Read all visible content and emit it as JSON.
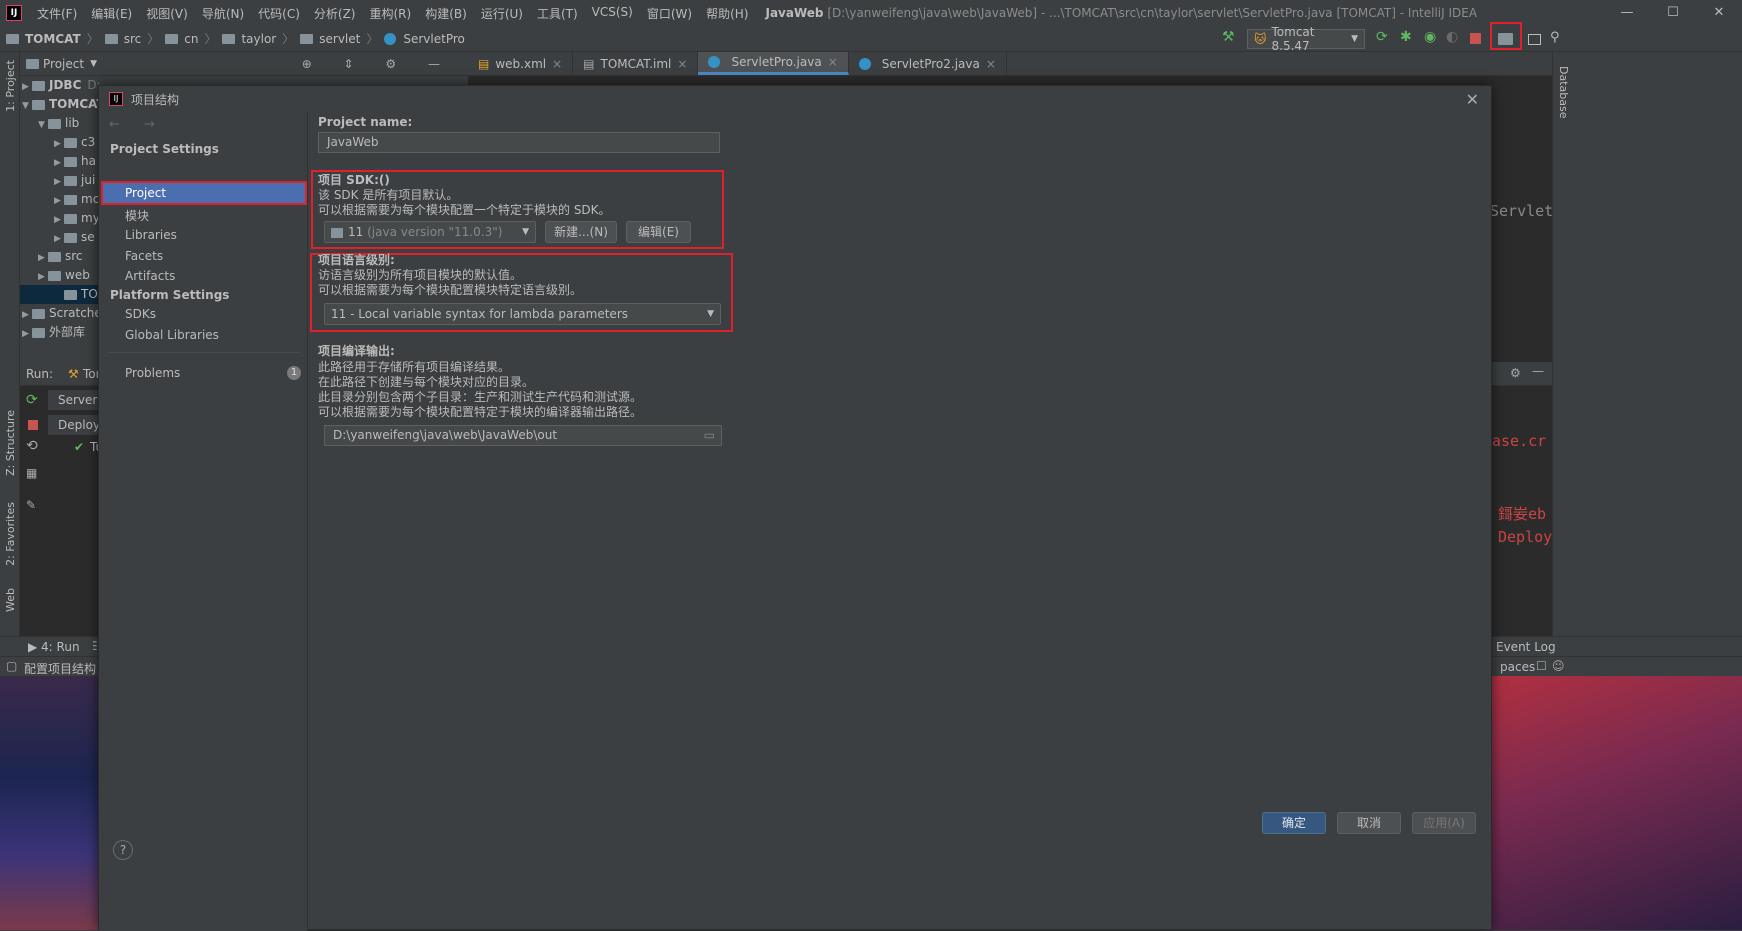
{
  "window": {
    "menus": [
      "文件(F)",
      "编辑(E)",
      "视图(V)",
      "导航(N)",
      "代码(C)",
      "分析(Z)",
      "重构(R)",
      "构建(B)",
      "运行(U)",
      "工具(T)",
      "VCS(S)",
      "窗口(W)",
      "帮助(H)"
    ],
    "title_bold": "JavaWeb",
    "title_rest": "[D:\\yanweifeng\\java\\web\\JavaWeb] - ...\\TOMCAT\\src\\cn\\taylor\\servlet\\ServletPro.java [TOMCAT] - IntelliJ IDEA",
    "min": "—",
    "max": "☐",
    "close": "✕"
  },
  "breadcrumb": [
    "TOMCAT",
    "src",
    "cn",
    "taylor",
    "servlet",
    "ServletPro"
  ],
  "run_config": "Tomcat 8.5.47",
  "left_strip": {
    "project": "1: Project",
    "structure": "Z: Structure",
    "favorites": "2: Favorites",
    "web": "Web"
  },
  "right_strip": {
    "database": "Database"
  },
  "project_panel": {
    "title": "Project",
    "tree": [
      {
        "arrow": "▶",
        "label": "JDBC",
        "extra": "D:..."
      },
      {
        "arrow": "▼",
        "label": "TOMCAT"
      },
      {
        "arrow": "▼",
        "label": "lib"
      },
      {
        "arrow": "▶",
        "label": "c3"
      },
      {
        "arrow": "▶",
        "label": "ha"
      },
      {
        "arrow": "▶",
        "label": "jui"
      },
      {
        "arrow": "▶",
        "label": "mc"
      },
      {
        "arrow": "▶",
        "label": "my"
      },
      {
        "arrow": "▶",
        "label": "se"
      },
      {
        "arrow": "▶",
        "label": "src"
      },
      {
        "arrow": "▶",
        "label": "web"
      },
      {
        "arrow": "",
        "label": "TOMC"
      },
      {
        "arrow": "▶",
        "label": "Scratche"
      },
      {
        "arrow": "▶",
        "label": "外部库"
      }
    ]
  },
  "editor_tabs": [
    "web.xml",
    "TOMCAT.iml",
    "ServletPro.java",
    "ServletPro2.java"
  ],
  "run_panel": {
    "label": "Run:",
    "tab": "Tor",
    "server": "Server",
    "deploy": "Deploym",
    "deploy_item": "Tu"
  },
  "editor_fragments": {
    "servlet": "Servlet",
    "red1": "ase.cr",
    "red2": "鎶妛eb",
    "red3": "Deploy"
  },
  "bottom": {
    "run_tab": "4: Run",
    "event_log": "Event Log",
    "status": "配置项目结构",
    "spaces": "paces"
  },
  "dialog": {
    "title": "项目结构",
    "nav_arrows": "← →",
    "section_project_settings": "Project Settings",
    "project_settings_items": [
      "Project",
      "模块",
      "Libraries",
      "Facets",
      "Artifacts"
    ],
    "section_platform_settings": "Platform Settings",
    "platform_items": [
      "SDKs",
      "Global Libraries"
    ],
    "problems": "Problems",
    "problems_count": "1",
    "project_name_label": "Project name:",
    "project_name_value": "JavaWeb",
    "sdk_label": "项目 SDK:()",
    "sdk_desc1": "该 SDK 是所有项目默认。",
    "sdk_desc2": "可以根据需要为每个模块配置一个特定于模块的 SDK。",
    "sdk_version": "11",
    "sdk_version_detail": "(java version \"11.0.3\")",
    "sdk_new_button": "新建...(N)",
    "sdk_edit_button": "编辑(E)",
    "lang_label": "项目语言级别:",
    "lang_desc1": "访语言级别为所有项目模块的默认值。",
    "lang_desc2": "可以根据需要为每个模块配置模块特定语言级别。",
    "lang_value": "11 - Local variable syntax for lambda parameters",
    "output_label": "项目编译输出:",
    "output_desc": [
      "此路径用于存储所有项目编译结果。",
      "在此路径下创建与每个模块对应的目录。",
      "此目录分别包含两个子目录：生产和测试生产代码和测试源。",
      "可以根据需要为每个模块配置特定于模块的编译器输出路径。"
    ],
    "output_value": "D:\\yanweifeng\\java\\web\\JavaWeb\\out",
    "ok": "确定",
    "cancel": "取消",
    "apply": "应用(A)",
    "help": "?"
  }
}
